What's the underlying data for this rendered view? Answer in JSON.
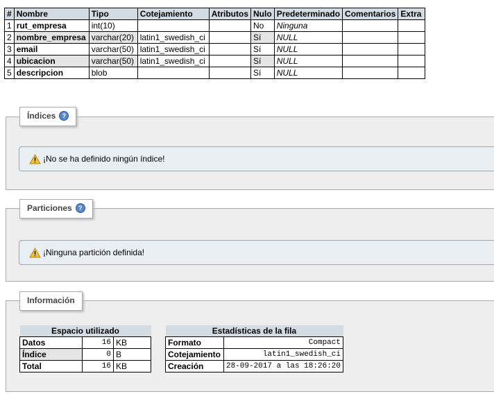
{
  "structure": {
    "headers": [
      "#",
      "Nombre",
      "Tipo",
      "Cotejamiento",
      "Atributos",
      "Nulo",
      "Predeterminado",
      "Comentarios",
      "Extra"
    ],
    "rows": [
      {
        "num": "1",
        "name": "rut_empresa",
        "type": "int(10)",
        "collation": "",
        "attributes": "",
        "null": "No",
        "default": "Ninguna",
        "comments": "",
        "extra": ""
      },
      {
        "num": "2",
        "name": "nombre_empresa",
        "type": "varchar(20)",
        "collation": "latin1_swedish_ci",
        "attributes": "",
        "null": "Sí",
        "default": "NULL",
        "comments": "",
        "extra": ""
      },
      {
        "num": "3",
        "name": "email",
        "type": "varchar(50)",
        "collation": "latin1_swedish_ci",
        "attributes": "",
        "null": "Sí",
        "default": "NULL",
        "comments": "",
        "extra": ""
      },
      {
        "num": "4",
        "name": "ubicacion",
        "type": "varchar(50)",
        "collation": "latin1_swedish_ci",
        "attributes": "",
        "null": "Sí",
        "default": "NULL",
        "comments": "",
        "extra": ""
      },
      {
        "num": "5",
        "name": "descripcion",
        "type": "blob",
        "collation": "",
        "attributes": "",
        "null": "Sí",
        "default": "NULL",
        "comments": "",
        "extra": ""
      }
    ]
  },
  "indices": {
    "legend": "Índices",
    "notice": "¡No se ha definido ningún índice!"
  },
  "partitions": {
    "legend": "Particiones",
    "notice": "¡Ninguna partición definida!"
  },
  "information": {
    "legend": "Información",
    "space": {
      "title": "Espacio utilizado",
      "rows": [
        {
          "label": "Datos",
          "value": "16",
          "unit": "KB"
        },
        {
          "label": "Índice",
          "value": "0",
          "unit": "B"
        },
        {
          "label": "Total",
          "value": "16",
          "unit": "KB"
        }
      ]
    },
    "row_stats": {
      "title": "Estadísticas de la fila",
      "rows": [
        {
          "label": "Formato",
          "value": "Compact"
        },
        {
          "label": "Cotejamiento",
          "value": "latin1_swedish_ci"
        },
        {
          "label": "Creación",
          "value": "28-09-2017 a las 18:26:20"
        }
      ]
    }
  },
  "icons": {
    "help": "help-icon",
    "warning": "warning-icon"
  },
  "colors": {
    "header_bg": "#d3dce3",
    "fieldset_bg": "#eeeeee",
    "notice_bg": "#e8eef1",
    "help_icon": "#5a87c9"
  }
}
